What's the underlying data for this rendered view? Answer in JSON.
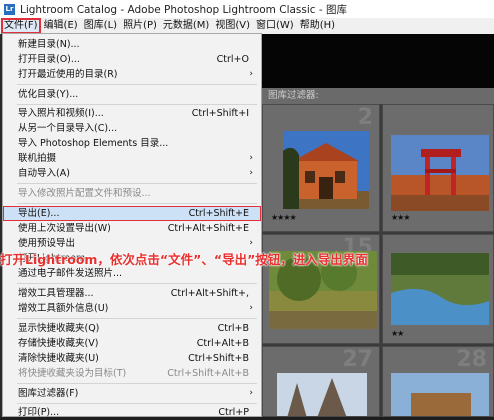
{
  "window": {
    "title": "Lightroom Catalog - Adobe Photoshop Lightroom Classic - 图库",
    "app_icon": "Lr"
  },
  "menubar": [
    "文件(F)",
    "编辑(E)",
    "图库(L)",
    "照片(P)",
    "元数据(M)",
    "视图(V)",
    "窗口(W)",
    "帮助(H)"
  ],
  "filter_bar": {
    "label": "图库过滤器:"
  },
  "menu_items": [
    {
      "label": "新建目录(N)...",
      "shortcut": ""
    },
    {
      "label": "打开目录(O)...",
      "shortcut": "Ctrl+O"
    },
    {
      "label": "打开最近使用的目录(R)",
      "shortcut": "",
      "submenu": true
    },
    {
      "label": "优化目录(Y)...",
      "shortcut": ""
    },
    {
      "label": "导入照片和视频(I)...",
      "shortcut": "Ctrl+Shift+I"
    },
    {
      "label": "从另一个目录导入(C)...",
      "shortcut": ""
    },
    {
      "label": "导入 Photoshop Elements 目录...",
      "shortcut": ""
    },
    {
      "label": "联机拍摄",
      "shortcut": "",
      "submenu": true
    },
    {
      "label": "自动导入(A)",
      "shortcut": "",
      "submenu": true
    },
    {
      "label": "导入修改照片配置文件和预设...",
      "shortcut": "",
      "disabled": true
    },
    {
      "label": "导出(E)...",
      "shortcut": "Ctrl+Shift+E",
      "highlighted": true
    },
    {
      "label": "使用上次设置导出(W)",
      "shortcut": "Ctrl+Alt+Shift+E"
    },
    {
      "label": "使用预设导出",
      "shortcut": "",
      "submenu": true
    },
    {
      "label": "打开Lightroom",
      "shortcut": ""
    },
    {
      "label": "通过电子邮件发送照片...",
      "shortcut": ""
    },
    {
      "label": "增效工具管理器...",
      "shortcut": "Ctrl+Alt+Shift+,"
    },
    {
      "label": "增效工具额外信息(U)",
      "shortcut": "",
      "submenu": true
    },
    {
      "label": "显示快捷收藏夹(Q)",
      "shortcut": "Ctrl+B"
    },
    {
      "label": "存储快捷收藏夹(V)",
      "shortcut": "Ctrl+Alt+B"
    },
    {
      "label": "清除快捷收藏夹(U)",
      "shortcut": "Ctrl+Shift+B"
    },
    {
      "label": "将快捷收藏夹设为目标(T)",
      "shortcut": "Ctrl+Shift+Alt+B",
      "disabled": true
    },
    {
      "label": "图库过滤器(F)",
      "shortcut": "",
      "submenu": true
    },
    {
      "label": "打印(P)...",
      "shortcut": "Ctrl+P"
    }
  ],
  "annotation": "打开Lightroom，依次点击“文件”、“导出”按钮，进入导出界面",
  "thumbnails": [
    {
      "number": "2",
      "stars": "★★★★"
    },
    {
      "number": "",
      "stars": "★★★"
    },
    {
      "number": "15",
      "stars": ""
    },
    {
      "number": "",
      "stars": "★★"
    },
    {
      "number": "27",
      "stars": ""
    },
    {
      "number": "28",
      "stars": ""
    }
  ],
  "colors": {
    "highlight_outline": "#e0303a",
    "menu_highlight": "#cce1f6",
    "annotation": "#e8302f"
  }
}
